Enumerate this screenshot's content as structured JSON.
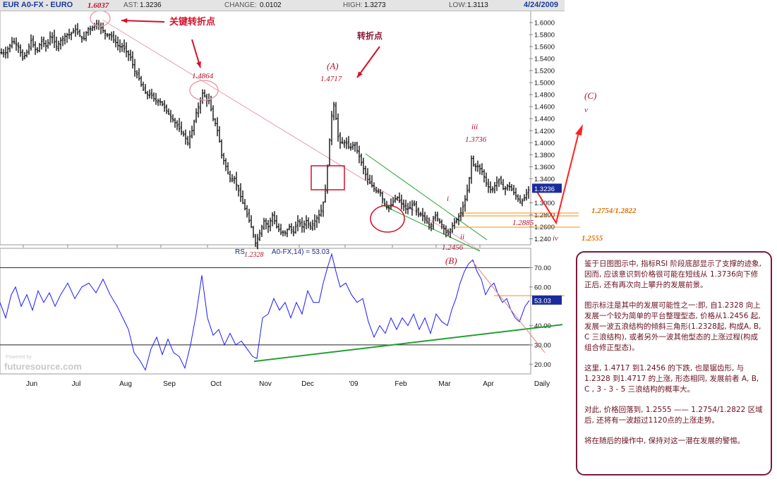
{
  "header": {
    "symbol": "EUR A0-FX - EURO",
    "last_label": "AST:",
    "last_value": "1.3236",
    "change_label": "CHANGE:",
    "change_value": "0.0102",
    "high_label": "HIGH:",
    "high_value": "1.3273",
    "low_label": "LOW:",
    "low_value": "1.3113",
    "date": "4/24/2009"
  },
  "chart_data": [
    {
      "type": "candlestick",
      "series": [
        {
          "name": "EUR A0-FX - EURO"
        }
      ],
      "x_labels": [
        "Jun",
        "Jul",
        "Aug",
        "Sep",
        "Oct",
        "Nov",
        "Dec",
        "'09",
        "Feb",
        "Mar",
        "Apr",
        "Daily"
      ],
      "y_ticks": [
        "1.6000",
        "1.5800",
        "1.5600",
        "1.5400",
        "1.5200",
        "1.5000",
        "1.4800",
        "1.4600",
        "1.4400",
        "1.4200",
        "1.4000",
        "1.3800",
        "1.3600",
        "1.3400",
        "1.3236",
        "1.3000",
        "1.2800",
        "1.2600",
        "1.240"
      ],
      "ylim": [
        1.23,
        1.62
      ],
      "last_price_tag": "1.3236",
      "path": [
        [
          0,
          1.55
        ],
        [
          8,
          1.55
        ],
        [
          18,
          1.57
        ],
        [
          26,
          1.56
        ],
        [
          32,
          1.54
        ],
        [
          38,
          1.55
        ],
        [
          44,
          1.57
        ],
        [
          52,
          1.55
        ],
        [
          58,
          1.57
        ],
        [
          66,
          1.56
        ],
        [
          72,
          1.58
        ],
        [
          80,
          1.56
        ],
        [
          86,
          1.57
        ],
        [
          94,
          1.58
        ],
        [
          100,
          1.58
        ],
        [
          106,
          1.59
        ],
        [
          112,
          1.58
        ],
        [
          118,
          1.57
        ],
        [
          124,
          1.59
        ],
        [
          130,
          1.59
        ],
        [
          136,
          1.6
        ],
        [
          140,
          1.5937
        ],
        [
          144,
          1.59
        ],
        [
          150,
          1.58
        ],
        [
          156,
          1.58
        ],
        [
          162,
          1.57
        ],
        [
          168,
          1.56
        ],
        [
          174,
          1.56
        ],
        [
          180,
          1.55
        ],
        [
          186,
          1.54
        ],
        [
          190,
          1.52
        ],
        [
          196,
          1.51
        ],
        [
          202,
          1.49
        ],
        [
          208,
          1.48
        ],
        [
          214,
          1.48
        ],
        [
          220,
          1.47
        ],
        [
          226,
          1.47
        ],
        [
          232,
          1.46
        ],
        [
          238,
          1.45
        ],
        [
          244,
          1.44
        ],
        [
          250,
          1.43
        ],
        [
          256,
          1.42
        ],
        [
          262,
          1.41
        ],
        [
          266,
          1.4
        ],
        [
          272,
          1.42
        ],
        [
          278,
          1.45
        ],
        [
          284,
          1.47
        ],
        [
          288,
          1.4864
        ],
        [
          292,
          1.47
        ],
        [
          296,
          1.47
        ],
        [
          302,
          1.44
        ],
        [
          306,
          1.43
        ],
        [
          310,
          1.41
        ],
        [
          314,
          1.38
        ],
        [
          320,
          1.36
        ],
        [
          326,
          1.34
        ],
        [
          332,
          1.34
        ],
        [
          338,
          1.32
        ],
        [
          344,
          1.3
        ],
        [
          350,
          1.28
        ],
        [
          356,
          1.26
        ],
        [
          362,
          1.2328
        ],
        [
          368,
          1.25
        ],
        [
          374,
          1.27
        ],
        [
          380,
          1.26
        ],
        [
          386,
          1.28
        ],
        [
          392,
          1.26
        ],
        [
          398,
          1.25
        ],
        [
          404,
          1.25
        ],
        [
          410,
          1.26
        ],
        [
          416,
          1.25
        ],
        [
          422,
          1.27
        ],
        [
          428,
          1.26
        ],
        [
          434,
          1.27
        ],
        [
          440,
          1.26
        ],
        [
          446,
          1.27
        ],
        [
          452,
          1.28
        ],
        [
          456,
          1.29
        ],
        [
          460,
          1.31
        ],
        [
          464,
          1.36
        ],
        [
          468,
          1.42
        ],
        [
          472,
          1.4717
        ],
        [
          476,
          1.44
        ],
        [
          480,
          1.4
        ],
        [
          484,
          1.4
        ],
        [
          490,
          1.4
        ],
        [
          496,
          1.39
        ],
        [
          502,
          1.4
        ],
        [
          508,
          1.38
        ],
        [
          514,
          1.36
        ],
        [
          520,
          1.34
        ],
        [
          526,
          1.33
        ],
        [
          532,
          1.32
        ],
        [
          538,
          1.32
        ],
        [
          544,
          1.3
        ],
        [
          550,
          1.29
        ],
        [
          556,
          1.3
        ],
        [
          562,
          1.31
        ],
        [
          568,
          1.3
        ],
        [
          574,
          1.29
        ],
        [
          580,
          1.29
        ],
        [
          586,
          1.3
        ],
        [
          592,
          1.28
        ],
        [
          598,
          1.28
        ],
        [
          604,
          1.27
        ],
        [
          610,
          1.26
        ],
        [
          616,
          1.28
        ],
        [
          622,
          1.27
        ],
        [
          628,
          1.26
        ],
        [
          634,
          1.2456
        ],
        [
          640,
          1.26
        ],
        [
          646,
          1.27
        ],
        [
          652,
          1.28
        ],
        [
          658,
          1.3
        ],
        [
          664,
          1.33
        ],
        [
          668,
          1.3736
        ],
        [
          672,
          1.36
        ],
        [
          678,
          1.36
        ],
        [
          684,
          1.35
        ],
        [
          690,
          1.33
        ],
        [
          696,
          1.32
        ],
        [
          702,
          1.33
        ],
        [
          708,
          1.34
        ],
        [
          714,
          1.32
        ],
        [
          720,
          1.33
        ],
        [
          726,
          1.32
        ],
        [
          732,
          1.31
        ],
        [
          738,
          1.3
        ],
        [
          744,
          1.31
        ],
        [
          750,
          1.3236
        ]
      ]
    },
    {
      "type": "line",
      "title": "RS",
      "legend_text": "RS",
      "legend_text2": "A0-FX,14) = 53.03",
      "series": [
        {
          "name": "RSI"
        }
      ],
      "y_ticks": [
        "70.00",
        "60.00",
        "53.03",
        "40.00",
        "30.00",
        "20.00"
      ],
      "ylim": [
        15,
        80
      ],
      "last_value_tag": "53.03",
      "points": [
        [
          0,
          52
        ],
        [
          8,
          44
        ],
        [
          16,
          56
        ],
        [
          22,
          60
        ],
        [
          30,
          50
        ],
        [
          38,
          56
        ],
        [
          46,
          48
        ],
        [
          54,
          58
        ],
        [
          62,
          52
        ],
        [
          70,
          57
        ],
        [
          78,
          50
        ],
        [
          86,
          56
        ],
        [
          96,
          62
        ],
        [
          106,
          54
        ],
        [
          116,
          60
        ],
        [
          126,
          62
        ],
        [
          136,
          57
        ],
        [
          146,
          64
        ],
        [
          156,
          56
        ],
        [
          166,
          50
        ],
        [
          174,
          44
        ],
        [
          182,
          38
        ],
        [
          190,
          26
        ],
        [
          198,
          22
        ],
        [
          206,
          17
        ],
        [
          214,
          28
        ],
        [
          222,
          34
        ],
        [
          230,
          25
        ],
        [
          238,
          33
        ],
        [
          246,
          26
        ],
        [
          254,
          24
        ],
        [
          262,
          18
        ],
        [
          270,
          30
        ],
        [
          278,
          46
        ],
        [
          286,
          66
        ],
        [
          294,
          44
        ],
        [
          302,
          35
        ],
        [
          310,
          38
        ],
        [
          318,
          30
        ],
        [
          326,
          36
        ],
        [
          334,
          30
        ],
        [
          342,
          32
        ],
        [
          350,
          28
        ],
        [
          358,
          24
        ],
        [
          364,
          23
        ],
        [
          372,
          44
        ],
        [
          380,
          46
        ],
        [
          388,
          54
        ],
        [
          396,
          48
        ],
        [
          404,
          52
        ],
        [
          412,
          44
        ],
        [
          420,
          52
        ],
        [
          428,
          46
        ],
        [
          436,
          58
        ],
        [
          444,
          52
        ],
        [
          452,
          52
        ],
        [
          458,
          62
        ],
        [
          464,
          70
        ],
        [
          470,
          77
        ],
        [
          476,
          68
        ],
        [
          482,
          60
        ],
        [
          490,
          62
        ],
        [
          498,
          56
        ],
        [
          506,
          52
        ],
        [
          514,
          54
        ],
        [
          522,
          42
        ],
        [
          530,
          34
        ],
        [
          538,
          40
        ],
        [
          546,
          36
        ],
        [
          554,
          44
        ],
        [
          562,
          38
        ],
        [
          570,
          44
        ],
        [
          578,
          40
        ],
        [
          586,
          46
        ],
        [
          594,
          38
        ],
        [
          602,
          44
        ],
        [
          610,
          36
        ],
        [
          618,
          46
        ],
        [
          626,
          42
        ],
        [
          634,
          40
        ],
        [
          640,
          48
        ],
        [
          646,
          54
        ],
        [
          652,
          62
        ],
        [
          658,
          68
        ],
        [
          664,
          72
        ],
        [
          670,
          74
        ],
        [
          676,
          68
        ],
        [
          682,
          64
        ],
        [
          688,
          56
        ],
        [
          694,
          60
        ],
        [
          700,
          62
        ],
        [
          706,
          56
        ],
        [
          712,
          52
        ],
        [
          718,
          54
        ],
        [
          724,
          48
        ],
        [
          730,
          44
        ],
        [
          736,
          42
        ],
        [
          744,
          50
        ],
        [
          750,
          53.03
        ]
      ]
    }
  ],
  "annotations": {
    "top_price": "1.6037",
    "key_turn": "关键转折点",
    "p14864": "1.4864",
    "turn": "转折点",
    "waveA": "(A)",
    "p14717": "1.4717",
    "wave3": "iii",
    "p13736": "1.3736",
    "waveC": "(C)",
    "wave5": "v",
    "wave1": "i",
    "wave2": "ii",
    "p12456": "1.2456",
    "waveB": "(B)",
    "p12885": "1.2885",
    "wave4": "iv",
    "zone": "1.2754/1.2822",
    "p12555": "1.2555",
    "p12328": "1.2328"
  },
  "watermark": {
    "powered": "Powered by",
    "site": "futuresource.com"
  },
  "commentary": {
    "p1": "鉴于日图图示中, 指标RSI 阶段底部显示了支撑的迹象, 因而, 应该意识到价格很可能在短线从 1.3736向下修正后, 还有再次向上攀升的发展前景。",
    "p2": "图示标注是其中的发展可能性之一:即, 自1.2328 向上发展一个较为简单的平台整理型态, 价格从1.2456 起, 发展一波五浪结构的倾斜三角形(1.2328起, 构成A, B, C 三浪结构), 或者另外一波其他型态的上涨过程(构成组合修正型态)。",
    "p3": "这里, 1.4717 到1.2456 的下跌, 也是锯齿形, 与1.2328 到1.4717 的上涨, 形态相同, 发展前者 A, B, C , 3 - 3 - 5 三浪结构的概率大。",
    "p4": "对此, 价格回落到, 1.2555 —— 1.2754/1.2822 区域后, 还将有一波超过1120点的上涨走势。",
    "p5": "将在随后的操作中, 保持对这一潜在发展的警惕。"
  },
  "colors": {
    "price": "#000000",
    "rsi": "#1a1aff",
    "annotation": "#cc1020",
    "support": "#22a030",
    "projection": "#ff2020",
    "zone": "#ff8c00",
    "tag_bg": "#1a2b9a"
  }
}
